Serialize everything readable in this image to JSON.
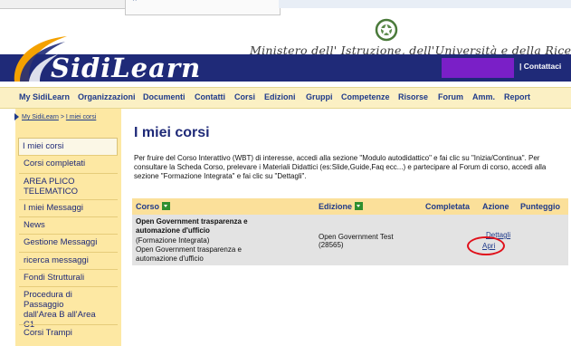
{
  "header": {
    "ministry": "Ministero dell' Istruzione, dell'Università e della Ricerca",
    "brand": "SidiLearn",
    "contatti": "| Contattaci",
    "colors": {
      "navy": "#1f2a78",
      "highlight": "#7a1fc7"
    }
  },
  "menu": [
    "My SidiLearn",
    "Organizzazioni",
    "Documenti",
    "Contatti",
    "Corsi",
    "Edizioni",
    "Gruppi",
    "Competenze",
    "Risorse",
    "Forum",
    "Amm.",
    "Report"
  ],
  "breadcrumb": {
    "home": "My SidiLearn",
    "sep": ">",
    "current": "I miei corsi"
  },
  "sidebar": [
    "I miei corsi",
    "Corsi completati",
    "AREA PLICO TELEMATICO",
    "I miei Messaggi",
    "News",
    "Gestione Messaggi",
    "ricerca messaggi",
    "Fondi Strutturali",
    "Procedura di Passaggio dall'Area B all'Area C1",
    "Corsi Trampi"
  ],
  "main": {
    "title": "I miei corsi",
    "intro": "Per fruire del Corso Interattivo (WBT) di interesse, accedi alla sezione \"Modulo autodidattico\" e fai clic su \"Inizia/Continua\". Per consultare la Scheda Corso, prelevare i Materiali Didattici (es:Slide,Guide,Faq ecc...) e partecipare al Forum di corso, accedi alla sezione \"Formazione Integrata\" e fai clic su \"Dettagli\"."
  },
  "table": {
    "columns": [
      "Corso",
      "Edizione",
      "Completata",
      "Azione",
      "Punteggio"
    ],
    "row": {
      "course_title": "Open Government trasparenza e automazione d'ufficio",
      "course_type": "(Formazione Integrata)",
      "course_desc": "Open Government trasparenza e automazione d'ufficio",
      "edition_name": "Open Government Test",
      "edition_code": "(28565)",
      "action_details": "Dettagli",
      "action_open": "Apri"
    }
  }
}
